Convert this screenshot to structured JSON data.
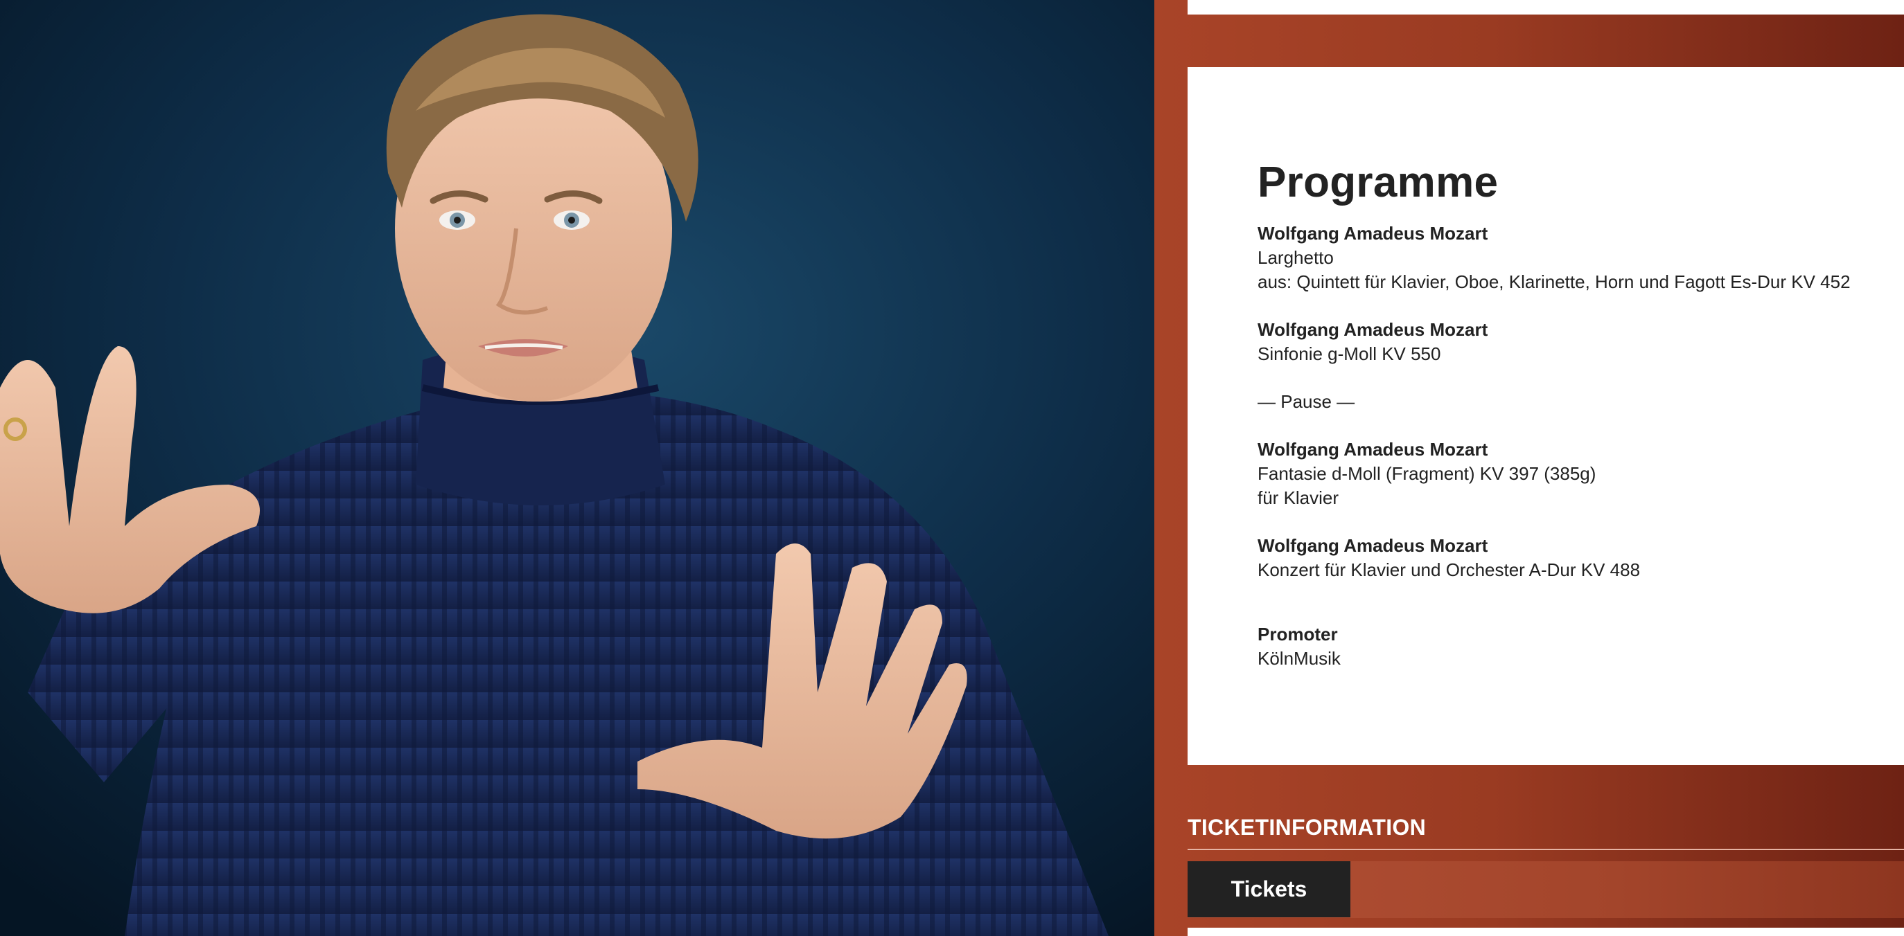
{
  "photo": {
    "alt": "Pianist in navy turtleneck gesturing with both hands"
  },
  "programme": {
    "title": "Programme",
    "items": [
      {
        "composer": "Wolfgang Amadeus Mozart",
        "lines": [
          "Larghetto",
          "aus: Quintett für Klavier, Oboe, Klarinette, Horn und Fagott Es-Dur KV 452"
        ]
      },
      {
        "composer": "Wolfgang Amadeus Mozart",
        "lines": [
          "Sinfonie g-Moll KV 550"
        ]
      },
      {
        "pause": "— Pause —"
      },
      {
        "composer": "Wolfgang Amadeus Mozart",
        "lines": [
          "Fantasie d-Moll (Fragment) KV 397 (385g)",
          "für Klavier"
        ]
      },
      {
        "composer": "Wolfgang Amadeus Mozart",
        "lines": [
          "Konzert für Klavier und Orchester A-Dur KV 488"
        ]
      }
    ]
  },
  "promoter": {
    "label": "Promoter",
    "value": "KölnMusik"
  },
  "tickets": {
    "heading": "TICKETINFORMATION",
    "button_label": "Tickets"
  },
  "colors": {
    "accent": "#a94428",
    "accent_dark": "#6e2214",
    "button_bg": "#222222",
    "backdrop": "#0d2a44"
  }
}
